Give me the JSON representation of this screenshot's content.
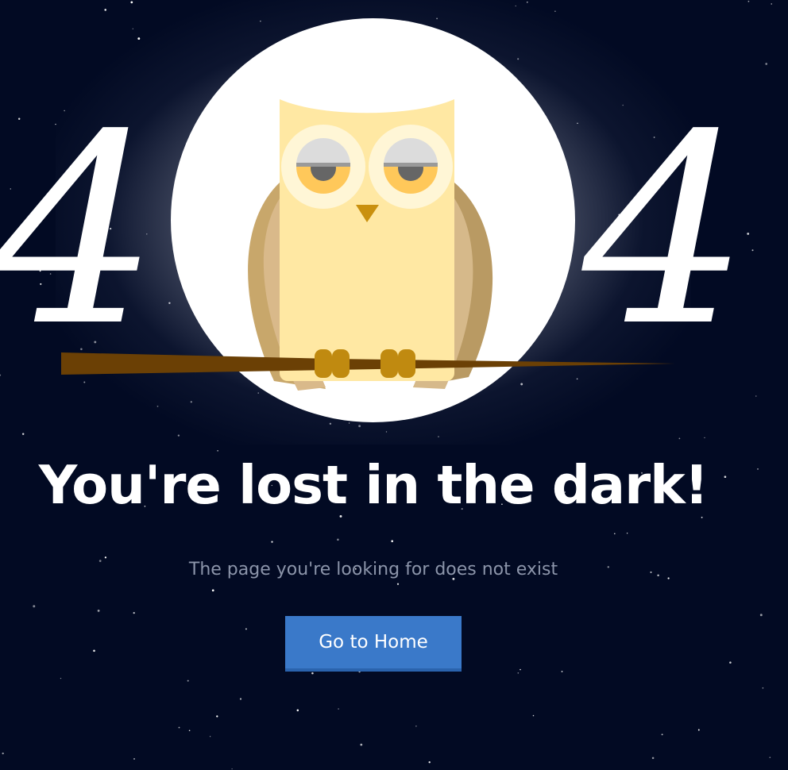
{
  "error_code": {
    "left_digit": "4",
    "right_digit": "4"
  },
  "headline": "You're lost in the dark!",
  "subtext": "The page you're looking for does not exist",
  "home_button": {
    "label": "Go to Home"
  },
  "colors": {
    "background": "#020a23",
    "moon": "#ffffff",
    "owl_body": "#ffe8a3",
    "owl_wing": "#c9a86a",
    "branch": "#6b4005",
    "button": "#3a79c9"
  }
}
